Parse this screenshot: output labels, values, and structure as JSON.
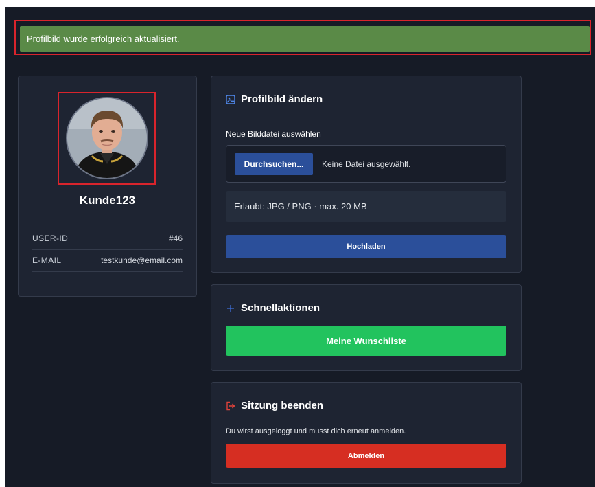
{
  "alert": {
    "message": "Profilbild wurde erfolgreich aktualisiert.",
    "color": "#5a8a47"
  },
  "profile": {
    "username": "Kunde123",
    "info": [
      {
        "key": "USER-ID",
        "value": "#46"
      },
      {
        "key": "E-MAIL",
        "value": "testkunde@email.com"
      }
    ]
  },
  "upload": {
    "title": "Profilbild ändern",
    "icon": "image-icon",
    "file_label": "Neue Bilddatei auswählen",
    "browse_label": "Durchsuchen...",
    "file_status": "Keine Datei ausgewählt.",
    "hint": "Erlaubt: JPG / PNG · max. 20 MB",
    "submit_label": "Hochladen",
    "accent": "#2b4f9a"
  },
  "quick": {
    "title": "Schnellaktionen",
    "icon": "plus-icon",
    "wishlist_label": "Meine Wunschliste",
    "accent": "#22c35e"
  },
  "logout": {
    "title": "Sitzung beenden",
    "icon": "logout-icon",
    "description": "Du wirst ausgeloggt und musst dich erneut anmelden.",
    "button_label": "Abmelden",
    "accent": "#d62e22"
  },
  "highlight_color": "#d9242c"
}
